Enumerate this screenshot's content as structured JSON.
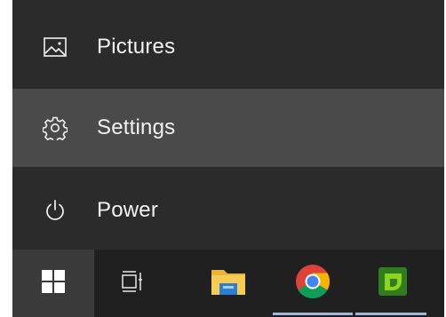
{
  "start_menu": {
    "items": [
      {
        "label": "Pictures",
        "icon": "pictures-icon"
      },
      {
        "label": "Settings",
        "icon": "gear-icon",
        "highlighted": true
      },
      {
        "label": "Power",
        "icon": "power-icon"
      }
    ]
  },
  "taskbar": {
    "buttons": [
      {
        "name": "start",
        "icon": "windows-logo-icon"
      },
      {
        "name": "task view",
        "icon": "task-view-icon"
      },
      {
        "name": "file explorer",
        "icon": "folder-icon"
      },
      {
        "name": "chrome",
        "icon": "chrome-icon",
        "running": true
      },
      {
        "name": "green app",
        "icon": "green-app-icon",
        "running": true
      }
    ]
  },
  "colors": {
    "menu_bg": "#2b2b2b",
    "hover_bg": "#4a4a4a",
    "taskbar_bg": "#202020",
    "text": "#f2f2f2",
    "running_indicator": "#9fb8d8"
  }
}
